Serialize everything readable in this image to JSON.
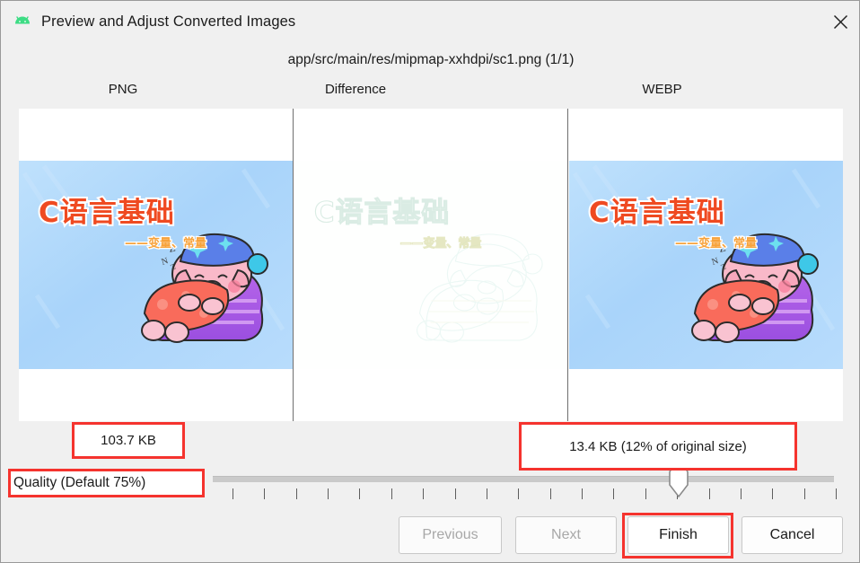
{
  "window": {
    "title": "Preview and Adjust Converted Images",
    "app_icon": "android-robot-icon",
    "close_icon": "close-icon"
  },
  "path_caption": "app/src/main/res/mipmap-xxhdpi/sc1.png (1/1)",
  "columns": [
    {
      "id": "png",
      "label": "PNG"
    },
    {
      "id": "difference",
      "label": "Difference"
    },
    {
      "id": "webp",
      "label": "WEBP"
    }
  ],
  "artwork": {
    "title": "C语言基础",
    "subtitle": "——变量、常量",
    "sleep_text": "Z",
    "background_color": "#aed6fb",
    "title_color": "#ef4a21",
    "subtitle_color": "#f7a23a"
  },
  "sizes": {
    "png": "103.7 KB",
    "webp": "13.4 KB (12% of original size)"
  },
  "quality": {
    "label": "Quality (Default 75%)",
    "value": 75,
    "min": 0,
    "max": 100,
    "tick_count": 20
  },
  "buttons": {
    "previous": "Previous",
    "next": "Next",
    "finish": "Finish",
    "cancel": "Cancel"
  },
  "annotation_color": "#f5332e"
}
